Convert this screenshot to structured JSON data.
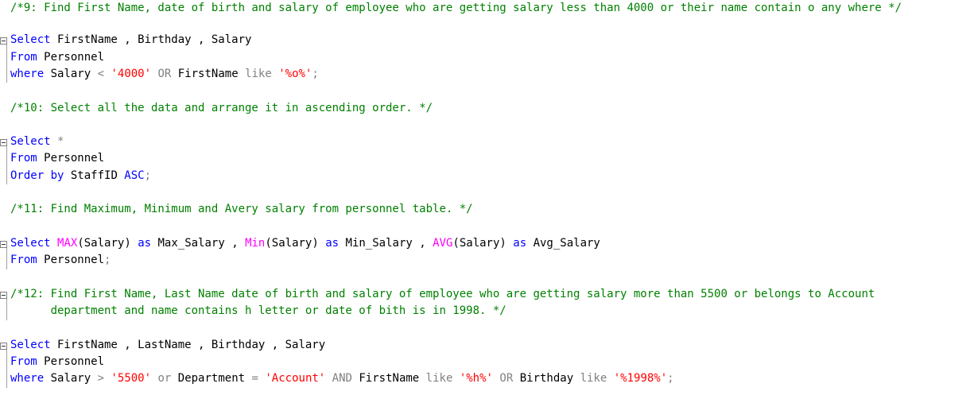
{
  "code": {
    "c9": "/*9: Find First Name, date of birth and salary of employee who are getting salary less than 4000 or their name contain o any where */",
    "q1": {
      "select": "Select",
      "cols": " FirstName , Birthday , Salary",
      "from": "From",
      "table": " Personnel",
      "where": "where",
      "w1": " Salary ",
      "lt": "<",
      "sp1": " ",
      "v1": "'4000'",
      "or": " OR",
      "w2": " FirstName ",
      "like": "like",
      "sp2": " ",
      "v2": "'%o%'",
      "semi": ";"
    },
    "c10": "/*10: Select all the data and arrange it in ascending order. */",
    "q2": {
      "select": "Select",
      "star": " *",
      "from": "From",
      "table": " Personnel",
      "order": "Order by",
      "col": " StaffID ",
      "asc": "ASC",
      "semi": ";"
    },
    "c11": "/*11: Find Maximum, Minimum and Avery salary from personnel table. */",
    "q3": {
      "select": "Select",
      "max": "MAX",
      "arg1": "(Salary)",
      "as1": "as",
      "a1": " Max_Salary , ",
      "min": "Min",
      "arg2": "(Salary)",
      "as2": "as",
      "a2": " Min_Salary , ",
      "avg": "AVG",
      "arg3": "(Salary)",
      "as3": "as",
      "a3": " Avg_Salary",
      "from": "From",
      "table": " Personnel",
      "semi": ";"
    },
    "c12a": "/*12: Find First Name, Last Name date of birth and salary of employee who are getting salary more than 5500 or belongs to Account",
    "c12b": "      department and name contains h letter or date of bith is in 1998. */",
    "q4": {
      "select": "Select",
      "cols": " FirstName , LastName , Birthday , Salary",
      "from": "From",
      "table": " Personnel",
      "where": "where",
      "w1": " Salary ",
      "gt": ">",
      "sp1": " ",
      "v1": "'5500'",
      "or1": " or",
      "w2": " Department ",
      "eq": "=",
      "sp2": " ",
      "v2": "'Account'",
      "and": " AND",
      "w3": " FirstName ",
      "like1": "like",
      "sp3": " ",
      "v3": "'%h%'",
      "or2": " OR",
      "w4": " Birthday ",
      "like2": "like",
      "sp4": " ",
      "v4": "'%1998%'",
      "semi": ";"
    }
  }
}
